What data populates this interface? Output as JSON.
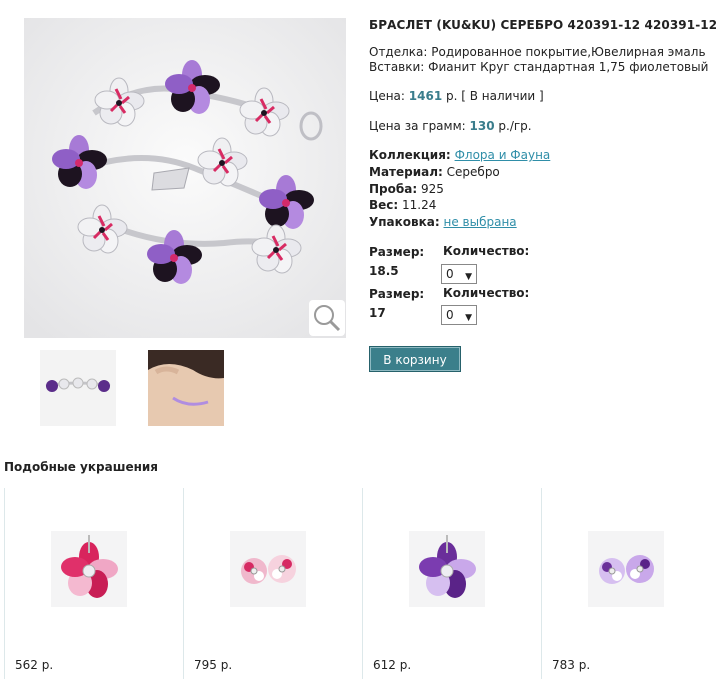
{
  "product": {
    "title": "БРАСЛЕТ (KU&KU) СЕРЕБРО 420391-12 420391-12",
    "finish_line": "Отделка: Родированное покрытие,Ювелирная эмаль",
    "inserts_line": "Вставки: Фианит Круг стандартная 1,75 фиолетовый",
    "price_label": "Цена:",
    "price_value": "1461",
    "price_suffix": "р. [ В наличии ]",
    "gram_label": "Цена за грамм:",
    "gram_value": "130",
    "gram_suffix": "р./гр.",
    "collection_label": "Коллекция:",
    "collection_value": "Флора и Фауна",
    "material_label": "Материал:",
    "material_value": "Серебро",
    "probe_label": "Проба:",
    "probe_value": "925",
    "weight_label": "Вес:",
    "weight_value": "11.24",
    "package_label": "Упаковка:",
    "package_value": "не выбрана"
  },
  "sizes": [
    {
      "size_label": "Размер:",
      "size_value": "18.5",
      "qty_label": "Количество:",
      "qty_value": "0"
    },
    {
      "size_label": "Размер:",
      "size_value": "17",
      "qty_label": "Количество:",
      "qty_value": "0"
    }
  ],
  "cart_button": "В корзину",
  "similar": {
    "title": "Подобные украшения",
    "items": [
      {
        "price": "562 р."
      },
      {
        "price": "795 р."
      },
      {
        "price": "612 р."
      },
      {
        "price": "783 р."
      }
    ]
  },
  "icons": {
    "zoom": "magnifier-icon",
    "select_arrow": "chevron-down-icon"
  },
  "colors": {
    "accent": "#3a7d8c",
    "link": "#2f8ea8",
    "button": "#3b7f8b",
    "enamel_violet": "#9b6fd0",
    "enamel_black": "#1a0f1e",
    "enamel_pink": "#e0306a"
  }
}
